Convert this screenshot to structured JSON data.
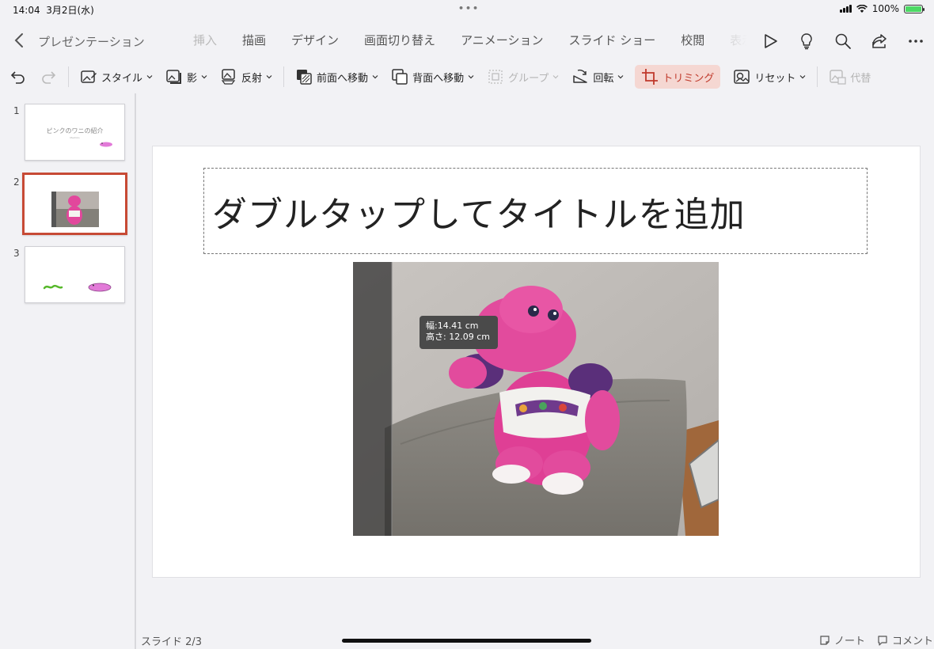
{
  "status": {
    "time": "14:04",
    "date": "3月2日(水)",
    "battery": "100%"
  },
  "header": {
    "back_title": "プレゼンテーション"
  },
  "tabs": [
    "挿入",
    "描画",
    "デザイン",
    "画面切り替え",
    "アニメーション",
    "スライド ショー",
    "校閲",
    "表示"
  ],
  "toolbar": {
    "style": "スタイル",
    "shadow": "影",
    "reflection": "反射",
    "bring_forward": "前面へ移動",
    "send_backward": "背面へ移動",
    "group": "グループ",
    "rotate": "回転",
    "crop": "トリミング",
    "reset": "リセット",
    "alt": "代替"
  },
  "thumbnails": [
    {
      "num": "1",
      "title": "ピンクのワニの紹介",
      "subtitle": "Machiko"
    },
    {
      "num": "2"
    },
    {
      "num": "3"
    }
  ],
  "slide": {
    "title_placeholder": "ダブルタップしてタイトルを追加"
  },
  "crop_tooltip": {
    "width": "幅:14.41 cm",
    "height": "高さ: 12.09 cm"
  },
  "footer": {
    "slide_count": "スライド 2/3",
    "notes": "ノート",
    "comments": "コメント"
  },
  "colors": {
    "accent": "#c74a35",
    "crop_bg": "#f5d7d2"
  }
}
